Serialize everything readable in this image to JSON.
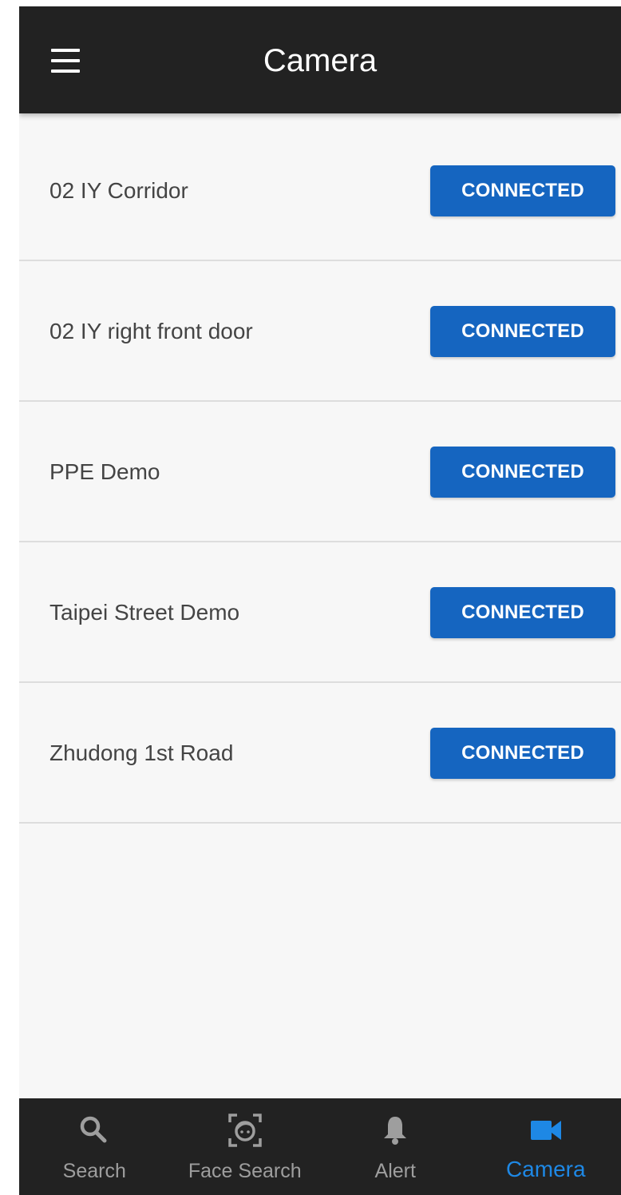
{
  "appbar": {
    "title": "Camera",
    "menu_icon": "hamburger-menu-icon"
  },
  "cameras": [
    {
      "name": "02 IY Corridor",
      "status": "CONNECTED"
    },
    {
      "name": "02 IY right front door",
      "status": "CONNECTED"
    },
    {
      "name": "PPE Demo",
      "status": "CONNECTED"
    },
    {
      "name": "Taipei Street Demo",
      "status": "CONNECTED"
    },
    {
      "name": "Zhudong 1st Road",
      "status": "CONNECTED"
    }
  ],
  "bottom_nav": {
    "items": [
      {
        "label": "Search",
        "icon": "search-icon",
        "active": false
      },
      {
        "label": "Face Search",
        "icon": "face-scan-icon",
        "active": false
      },
      {
        "label": "Alert",
        "icon": "bell-icon",
        "active": false
      },
      {
        "label": "Camera",
        "icon": "video-camera-icon",
        "active": true
      }
    ]
  },
  "colors": {
    "appbar_bg": "#222222",
    "status_button": "#1565c0",
    "nav_active": "#1e88e5",
    "nav_inactive": "#9e9e9e",
    "list_bg": "#f7f7f7"
  }
}
